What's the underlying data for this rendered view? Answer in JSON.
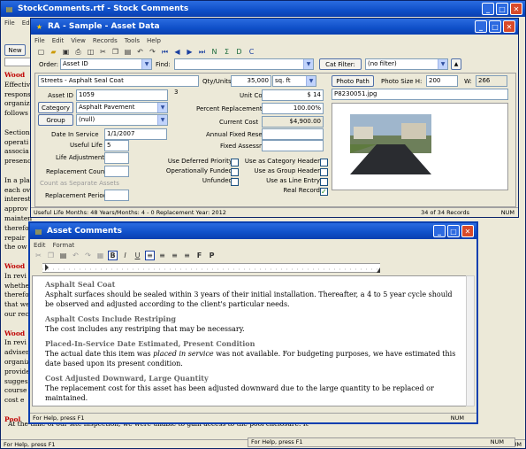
{
  "outer": {
    "title": "StockComments.rtf - Stock Comments",
    "menu": [
      "File",
      "Edit"
    ],
    "new_label": "New",
    "status": "For Help, press F1",
    "num": "NUM",
    "bg_lines": [
      {
        "t": "Wood",
        "red": true
      },
      {
        "t": "Effectiv"
      },
      {
        "t": "respons"
      },
      {
        "t": "organiz"
      },
      {
        "t": "follows"
      },
      {
        "t": ""
      },
      {
        "t": "Section"
      },
      {
        "t": "operati"
      },
      {
        "t": "associa"
      },
      {
        "t": "presenc"
      },
      {
        "t": ""
      },
      {
        "t": "In a pla"
      },
      {
        "t": "each ov"
      },
      {
        "t": "interest"
      },
      {
        "t": "approv"
      },
      {
        "t": "mainten"
      },
      {
        "t": "therefo"
      },
      {
        "t": "repair"
      },
      {
        "t": "the ow"
      },
      {
        "t": ""
      },
      {
        "t": "Wood",
        "red": true
      },
      {
        "t": "In revi"
      },
      {
        "t": "whethe"
      },
      {
        "t": "therefor"
      },
      {
        "t": "that we"
      },
      {
        "t": "our rec"
      },
      {
        "t": ""
      },
      {
        "t": "Wood",
        "red": true
      },
      {
        "t": "In revi"
      },
      {
        "t": "adviser"
      },
      {
        "t": "organiz"
      },
      {
        "t": "provide"
      },
      {
        "t": "sugges"
      },
      {
        "t": "course"
      },
      {
        "t": "cost e"
      },
      {
        "t": ""
      },
      {
        "t": "Pool",
        "red": true
      }
    ],
    "bottom_line": "At the time of our site inspection, we were unable to gain access to the pool enclosure.  It"
  },
  "second_status": {
    "text": "For Help, press F1",
    "num": "NUM"
  },
  "asset": {
    "title": "RA - Sample - Asset Data",
    "menu": [
      "File",
      "Edit",
      "View",
      "Records",
      "Tools",
      "Help"
    ],
    "order_label": "Order:",
    "order_value": "Asset ID",
    "find_label": "Find:",
    "find_value": "",
    "filter_button": "Cat Filter:",
    "filter_value": "(no filter)",
    "name": "Streets - Asphalt Seal Coat",
    "qty_label": "Qty/Units",
    "qty_value": "35,000",
    "unit_value": "sq. ft",
    "photo_path_button": "Photo Path",
    "photo_size_label": "Photo Size H:",
    "photo_h": "200",
    "photo_w_label": "W:",
    "photo_w": "266",
    "photo_file": "P8230051.jpg",
    "asset_id_label": "Asset ID",
    "asset_id": "1059",
    "asset_num": "3",
    "category_button": "Category",
    "category_value": "Asphalt Pavement",
    "group_button": "Group",
    "group_value": "(null)",
    "unit_cost_label": "Unit Cost",
    "unit_cost": "$ 14",
    "pct_label": "Percent Replacement",
    "pct": "100.00%",
    "cur_cost_label": "Current Cost",
    "cur_cost": "$4,900.00",
    "date_label": "Date In Service",
    "date": "1/1/2007",
    "life_label": "Useful Life",
    "life": "5",
    "adj_label": "Life Adjustment",
    "adj": "",
    "rcount_label": "Replacement Count",
    "rcount": "",
    "sep_label": "Count as Separate Assets",
    "rperiod_label": "Replacement Period",
    "rperiod": "",
    "afr_label": "Annual Fixed Reserves",
    "fa_label": "Fixed Assessment",
    "checks": [
      {
        "label": "Use Deferred Priority",
        "c": false
      },
      {
        "label": "Operationally Funded",
        "c": false
      },
      {
        "label": "Unfunded",
        "c": false
      }
    ],
    "checks2": [
      {
        "label": "Use as Category Header",
        "c": false
      },
      {
        "label": "Use as Group Header",
        "c": false
      },
      {
        "label": "Use as Line Entry",
        "c": false
      },
      {
        "label": "Real Record",
        "c": true
      }
    ],
    "status": "Useful Life Months: 48    Years/Months: 4 - 0    Replacement Year: 2012",
    "records": "34 of 34 Records",
    "num": "NUM"
  },
  "comments": {
    "title": "Asset Comments",
    "menu": [
      "Edit",
      "Format"
    ],
    "status": "For Help, press F1",
    "num": "NUM",
    "fmt": {
      "bold": "B",
      "italic": "I",
      "under": "U",
      "f": "F",
      "p": "P"
    },
    "sections": [
      {
        "h": "Asphalt Seal Coat",
        "b": "Asphalt surfaces should be sealed within 3 years of their initial installation.  Thereafter, a 4 to 5 year cycle should be observed and adjusted according to the client's particular needs."
      },
      {
        "h": "Asphalt Costs Include Restriping",
        "b": "The cost includes any restriping that may be necessary."
      },
      {
        "h": "Placed-In-Service Date Estimated, Present Condition",
        "b1": "The actual date this item was ",
        "bi": "placed in service",
        "b2": " was not available.  For budgeting purposes, we have estimated this date based upon its present condition."
      },
      {
        "h": "Cost Adjusted Downward, Large Quantity",
        "b": "The replacement cost for this asset has been adjusted downward due to the large quantity to be replaced or maintained."
      }
    ]
  },
  "colors": {
    "title_blue": "#0f4fc8",
    "heading_gray": "#666666",
    "red": "#c00000"
  }
}
